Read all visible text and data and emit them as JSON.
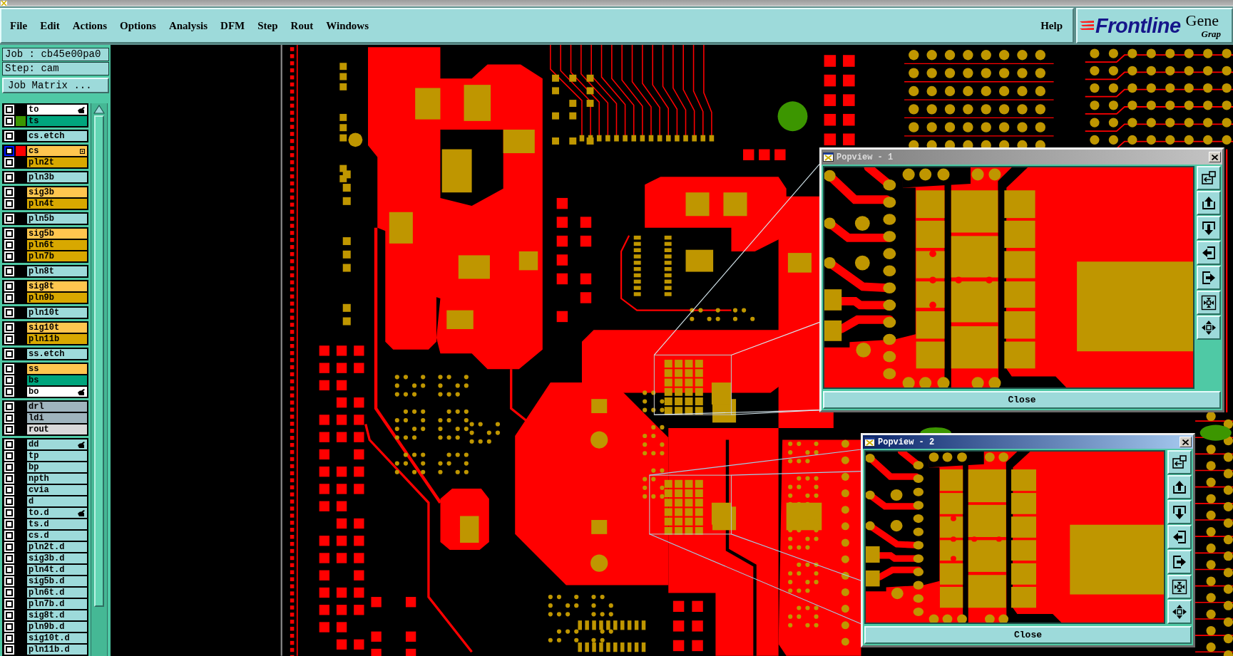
{
  "menu_bar": {
    "menus": [
      "File",
      "Edit",
      "Actions",
      "Options",
      "Analysis",
      "DFM",
      "Step",
      "Rout",
      "Windows"
    ],
    "help": "Help"
  },
  "logo": {
    "brand": "Frontline",
    "product": "Gene",
    "subtitle": "Grap"
  },
  "job_panel": {
    "job": "Job : cb45e00pa0",
    "step": "Step: cam",
    "matrix_button": "Job Matrix ..."
  },
  "layers": {
    "groups": [
      {
        "layers": [
          {
            "name": "to",
            "color": "#ffffff",
            "checked": false,
            "selected": false,
            "marker": {
              "kind": "pointer"
            }
          },
          {
            "name": "ts",
            "color": "#00a57d",
            "checked": false,
            "selected": false,
            "swatch": {
              "color": "#3c9600"
            }
          }
        ]
      },
      {
        "layers": [
          {
            "name": "cs.etch",
            "color": "#9ddada",
            "checked": false,
            "selected": false
          }
        ]
      },
      {
        "layers": [
          {
            "name": "cs",
            "color": "#ffc64f",
            "checked": false,
            "selected": true,
            "swatch": {
              "color": "#ff0000"
            },
            "marker": {
              "kind": "grid"
            }
          },
          {
            "name": "pln2t",
            "color": "#d8a800",
            "checked": false,
            "selected": false
          }
        ]
      },
      {
        "layers": [
          {
            "name": "pln3b",
            "color": "#9ddada",
            "checked": false,
            "selected": false
          }
        ]
      },
      {
        "layers": [
          {
            "name": "sig3b",
            "color": "#ffc64f",
            "checked": false,
            "selected": false
          },
          {
            "name": "pln4t",
            "color": "#d8a800",
            "checked": false,
            "selected": false
          }
        ]
      },
      {
        "layers": [
          {
            "name": "pln5b",
            "color": "#9ddada",
            "checked": false,
            "selected": false
          }
        ]
      },
      {
        "layers": [
          {
            "name": "sig5b",
            "color": "#ffc64f",
            "checked": false,
            "selected": false
          },
          {
            "name": "pln6t",
            "color": "#d8a800",
            "checked": false,
            "selected": false
          },
          {
            "name": "pln7b",
            "color": "#d8a800",
            "checked": false,
            "selected": false
          }
        ]
      },
      {
        "layers": [
          {
            "name": "pln8t",
            "color": "#9ddada",
            "checked": false,
            "selected": false
          }
        ]
      },
      {
        "layers": [
          {
            "name": "sig8t",
            "color": "#ffc64f",
            "checked": false,
            "selected": false
          },
          {
            "name": "pln9b",
            "color": "#d8a800",
            "checked": false,
            "selected": false
          }
        ]
      },
      {
        "layers": [
          {
            "name": "pln10t",
            "color": "#9ddada",
            "checked": false,
            "selected": false
          }
        ]
      },
      {
        "layers": [
          {
            "name": "sig10t",
            "color": "#ffc64f",
            "checked": false,
            "selected": false
          },
          {
            "name": "pln11b",
            "color": "#d8a800",
            "checked": false,
            "selected": false
          }
        ]
      },
      {
        "layers": [
          {
            "name": "ss.etch",
            "color": "#9ddada",
            "checked": false,
            "selected": false
          }
        ]
      },
      {
        "layers": [
          {
            "name": "ss",
            "color": "#ffc64f",
            "checked": false,
            "selected": false
          },
          {
            "name": "bs",
            "color": "#00a57d",
            "checked": false,
            "selected": false
          },
          {
            "name": "bo",
            "color": "#ffffff",
            "checked": false,
            "selected": false,
            "marker": {
              "kind": "pointer"
            }
          }
        ]
      },
      {
        "layers": [
          {
            "name": "drl",
            "color": "#9fb4bd",
            "checked": false,
            "selected": false
          },
          {
            "name": "ldi",
            "color": "#9fb4bd",
            "checked": false,
            "selected": false
          },
          {
            "name": "rout",
            "color": "#d9d9d9",
            "checked": false,
            "selected": false
          }
        ]
      },
      {
        "layers": [
          {
            "name": "dd",
            "color": "#9ddada",
            "checked": false,
            "selected": false,
            "marker": {
              "kind": "pointer"
            }
          },
          {
            "name": "tp",
            "color": "#9ddada",
            "checked": false,
            "selected": false
          },
          {
            "name": "bp",
            "color": "#9ddada",
            "checked": false,
            "selected": false
          },
          {
            "name": "npth",
            "color": "#9ddada",
            "checked": false,
            "selected": false
          },
          {
            "name": "cvia",
            "color": "#9ddada",
            "checked": false,
            "selected": false
          },
          {
            "name": "d",
            "color": "#9ddada",
            "checked": false,
            "selected": false
          },
          {
            "name": "to.d",
            "color": "#9ddada",
            "checked": false,
            "selected": false,
            "marker": {
              "kind": "pointer"
            }
          },
          {
            "name": "ts.d",
            "color": "#9ddada",
            "checked": false,
            "selected": false
          },
          {
            "name": "cs.d",
            "color": "#9ddada",
            "checked": false,
            "selected": false
          },
          {
            "name": "pln2t.d",
            "color": "#9ddada",
            "checked": false,
            "selected": false
          },
          {
            "name": "sig3b.d",
            "color": "#9ddada",
            "checked": false,
            "selected": false
          },
          {
            "name": "pln4t.d",
            "color": "#9ddada",
            "checked": false,
            "selected": false
          },
          {
            "name": "sig5b.d",
            "color": "#9ddada",
            "checked": false,
            "selected": false
          },
          {
            "name": "pln6t.d",
            "color": "#9ddada",
            "checked": false,
            "selected": false
          },
          {
            "name": "pln7b.d",
            "color": "#9ddada",
            "checked": false,
            "selected": false
          },
          {
            "name": "sig8t.d",
            "color": "#9ddada",
            "checked": false,
            "selected": false
          },
          {
            "name": "pln9b.d",
            "color": "#9ddada",
            "checked": false,
            "selected": false
          },
          {
            "name": "sig10t.d",
            "color": "#9ddada",
            "checked": false,
            "selected": false
          },
          {
            "name": "pln11b.d",
            "color": "#9ddada",
            "checked": false,
            "selected": false
          }
        ]
      }
    ]
  },
  "popviews": [
    {
      "title": "Popview - 1",
      "active": false,
      "close_label": "Close"
    },
    {
      "title": "Popview - 2",
      "active": true,
      "close_label": "Close"
    }
  ]
}
